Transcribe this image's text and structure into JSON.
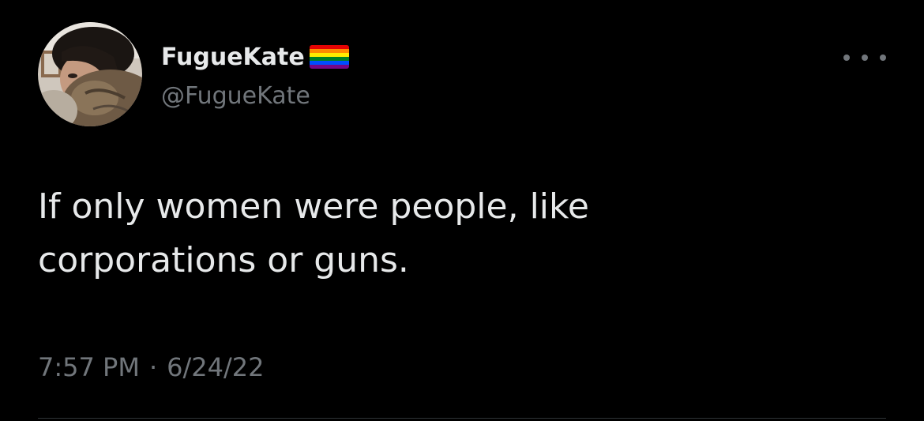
{
  "tweet": {
    "display_name": "FugueKate",
    "handle": "@FugueKate",
    "text_lines": [
      "If only women were people, like",
      "corporations or guns."
    ],
    "time": "7:57 PM",
    "separator": "·",
    "date": "6/24/22",
    "flag_colors": [
      "#e40303",
      "#ff8c00",
      "#ffed00",
      "#008026",
      "#004dff",
      "#750787"
    ],
    "more_icon": "more-horizontal-icon"
  },
  "colors": {
    "background": "#000000",
    "primary_text": "#e7e9ea",
    "secondary_text": "#71767b",
    "divider": "#2f3336"
  }
}
